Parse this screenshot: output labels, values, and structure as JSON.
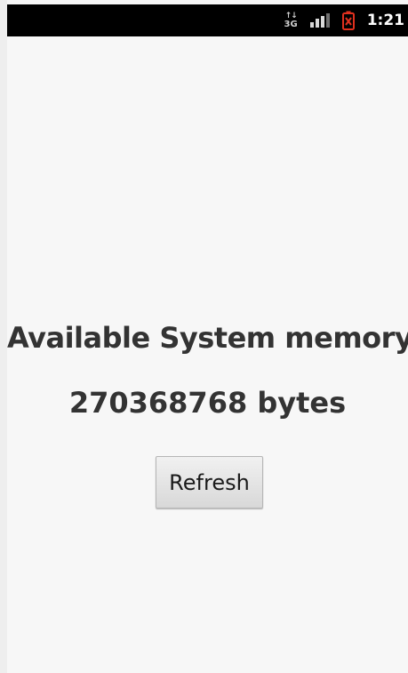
{
  "status_bar": {
    "network_label": "3G",
    "network_arrows": "↑↓",
    "signal_icon": "signal-strength-icon",
    "battery_icon": "battery-alert-icon",
    "battery_color": "#e0301e",
    "time": "1:21"
  },
  "main": {
    "heading": "Available System memory:",
    "memory_value": "270368768 bytes",
    "refresh_label": "Refresh"
  }
}
